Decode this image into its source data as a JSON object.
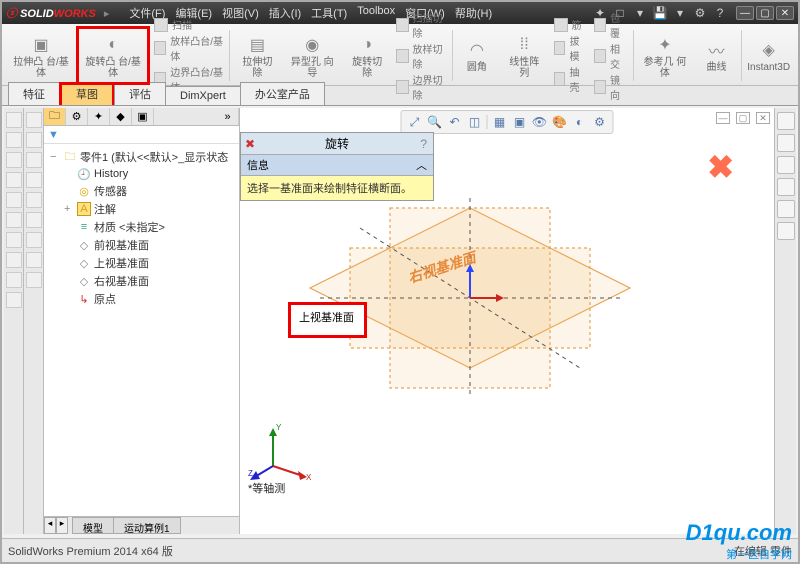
{
  "title": {
    "app_logo": {
      "prefix": "SOLID",
      "suffix": "WORKS"
    },
    "menus": [
      "文件(F)",
      "编辑(E)",
      "视图(V)",
      "插入(I)",
      "工具(T)",
      "Toolbox",
      "窗口(W)",
      "帮助(H)"
    ]
  },
  "ribbon": {
    "btn_extrude_boss": "拉伸凸\n台/基体",
    "btn_revolve_boss": "旋转凸\n台/基体",
    "stack1_rows": [
      "扫描",
      "放样凸台/基体",
      "边界凸台/基体"
    ],
    "btn_extrude_cut": "拉伸切\n除",
    "btn_hole_wizard": "异型孔\n向导",
    "btn_revolve_cut": "旋转切\n除",
    "stack2_rows": [
      "扫描切除",
      "放样切除",
      "边界切除"
    ],
    "btn_fillet": "圆角",
    "btn_linear_pattern": "线性阵\n列",
    "stack3_rows": [
      "筋",
      "拔模",
      "抽壳"
    ],
    "stack4_rows": [
      "包覆",
      "相交",
      "镜向"
    ],
    "btn_ref_geom": "参考几\n何体",
    "btn_curves": "曲线",
    "btn_instant3d": "Instant3D"
  },
  "tabs": [
    "特征",
    "草图",
    "评估",
    "DimXpert",
    "办公室产品"
  ],
  "fm": {
    "root": "零件1 (默认<<默认>_显示状态",
    "history": "History",
    "sensors": "传感器",
    "annotations": "注解",
    "material": "材质 <未指定>",
    "plane_front": "前视基准面",
    "plane_top": "上视基准面",
    "plane_right": "右视基准面",
    "origin": "原点",
    "bottom_tabs": [
      "模型",
      "运动算例1"
    ]
  },
  "pm": {
    "title": "旋转",
    "section": "信息",
    "message": "选择一基准面来绘制特征横断面。"
  },
  "viewport": {
    "hint_label": "上视基准面",
    "plane_text_right": "右视基准面",
    "iso_label": "*等轴测",
    "triad_x": "X",
    "triad_y": "Y",
    "triad_z": "Z"
  },
  "status": {
    "left": "SolidWorks Premium 2014 x64 版",
    "right": "在编辑 零件"
  },
  "watermark": {
    "main": "D1qu.com",
    "sub": "第一区自学网"
  }
}
